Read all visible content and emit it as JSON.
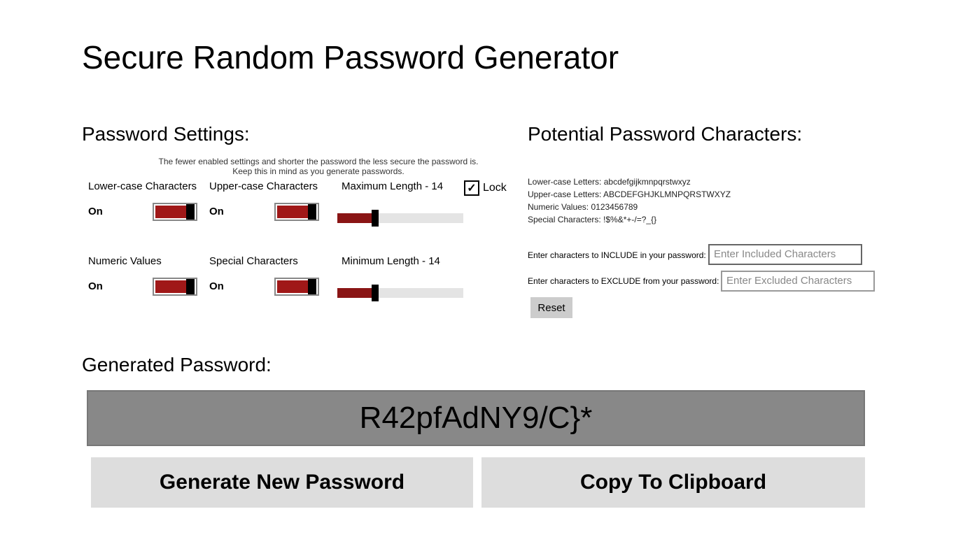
{
  "title": "Secure Random Password Generator",
  "sections": {
    "settings": "Password Settings:",
    "potential": "Potential Password Characters:",
    "generated": "Generated Password:"
  },
  "hint_line1": "The fewer enabled settings and shorter the password the less secure the password is.",
  "hint_line2": "Keep this in mind as you generate passwords.",
  "toggles": {
    "lower": {
      "label": "Lower-case Characters",
      "state": "On"
    },
    "upper": {
      "label": "Upper-case Characters",
      "state": "On"
    },
    "numeric": {
      "label": "Numeric Values",
      "state": "On"
    },
    "special": {
      "label": "Special Characters",
      "state": "On"
    }
  },
  "sliders": {
    "max": {
      "label": "Maximum Length - 14",
      "ratio": 0.3
    },
    "min": {
      "label": "Minimum Length - 14",
      "ratio": 0.3
    }
  },
  "lock": {
    "label": "Lock",
    "checked": true,
    "checkmark": "✓"
  },
  "charsets": {
    "lower": "Lower-case Letters: abcdefgijkmnpqrstwxyz",
    "upper": "Upper-case Letters: ABCDEFGHJKLMNPQRSTWXYZ",
    "numeric": "Numeric Values: 0123456789",
    "special": "Special Characters: !$%&*+-/=?_{}"
  },
  "include": {
    "label": "Enter characters to INCLUDE in your password:",
    "placeholder": "Enter Included Characters"
  },
  "exclude": {
    "label": "Enter characters to EXCLUDE from your password:",
    "placeholder": "Enter Excluded Characters"
  },
  "buttons": {
    "reset": "Reset",
    "generate": "Generate New Password",
    "copy": "Copy To Clipboard"
  },
  "generated_password": "R42pfAdNY9/C}*"
}
